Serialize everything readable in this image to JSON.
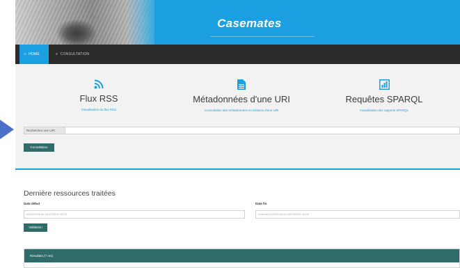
{
  "header": {
    "title": "Casemates"
  },
  "nav": {
    "home": "Home",
    "consultation": "Consultation"
  },
  "features": [
    {
      "icon": "rss-icon",
      "title": "Flux RSS",
      "subtitle": "Visualisation du flux RSS"
    },
    {
      "icon": "document-icon",
      "title": "Métadonnées d'une URI",
      "subtitle": "Consultation des métadonnées et relations d'une URI"
    },
    {
      "icon": "bar-chart-icon",
      "title": "Requêtes SPARQL",
      "subtitle": "Visualisation des rapports SPARQL"
    }
  ],
  "search": {
    "label": "Rechercher une URI",
    "value": "",
    "button": "Consultation"
  },
  "recent": {
    "title": "Dernière ressources traitées",
    "start_label": "Date début",
    "end_label": "Date fin",
    "start_value": "04/10/2016 au 04/10/2016 10:00",
    "end_value": "mois au 04/10/2016 au 04/10/2016 10:00",
    "validate": "Validation"
  },
  "results": {
    "header": "Résultats (7 res)"
  },
  "colors": {
    "primary": "#1c9fe0",
    "navbar": "#2b2b2b",
    "button": "#2f6b68",
    "panel": "#f2f2f2"
  }
}
